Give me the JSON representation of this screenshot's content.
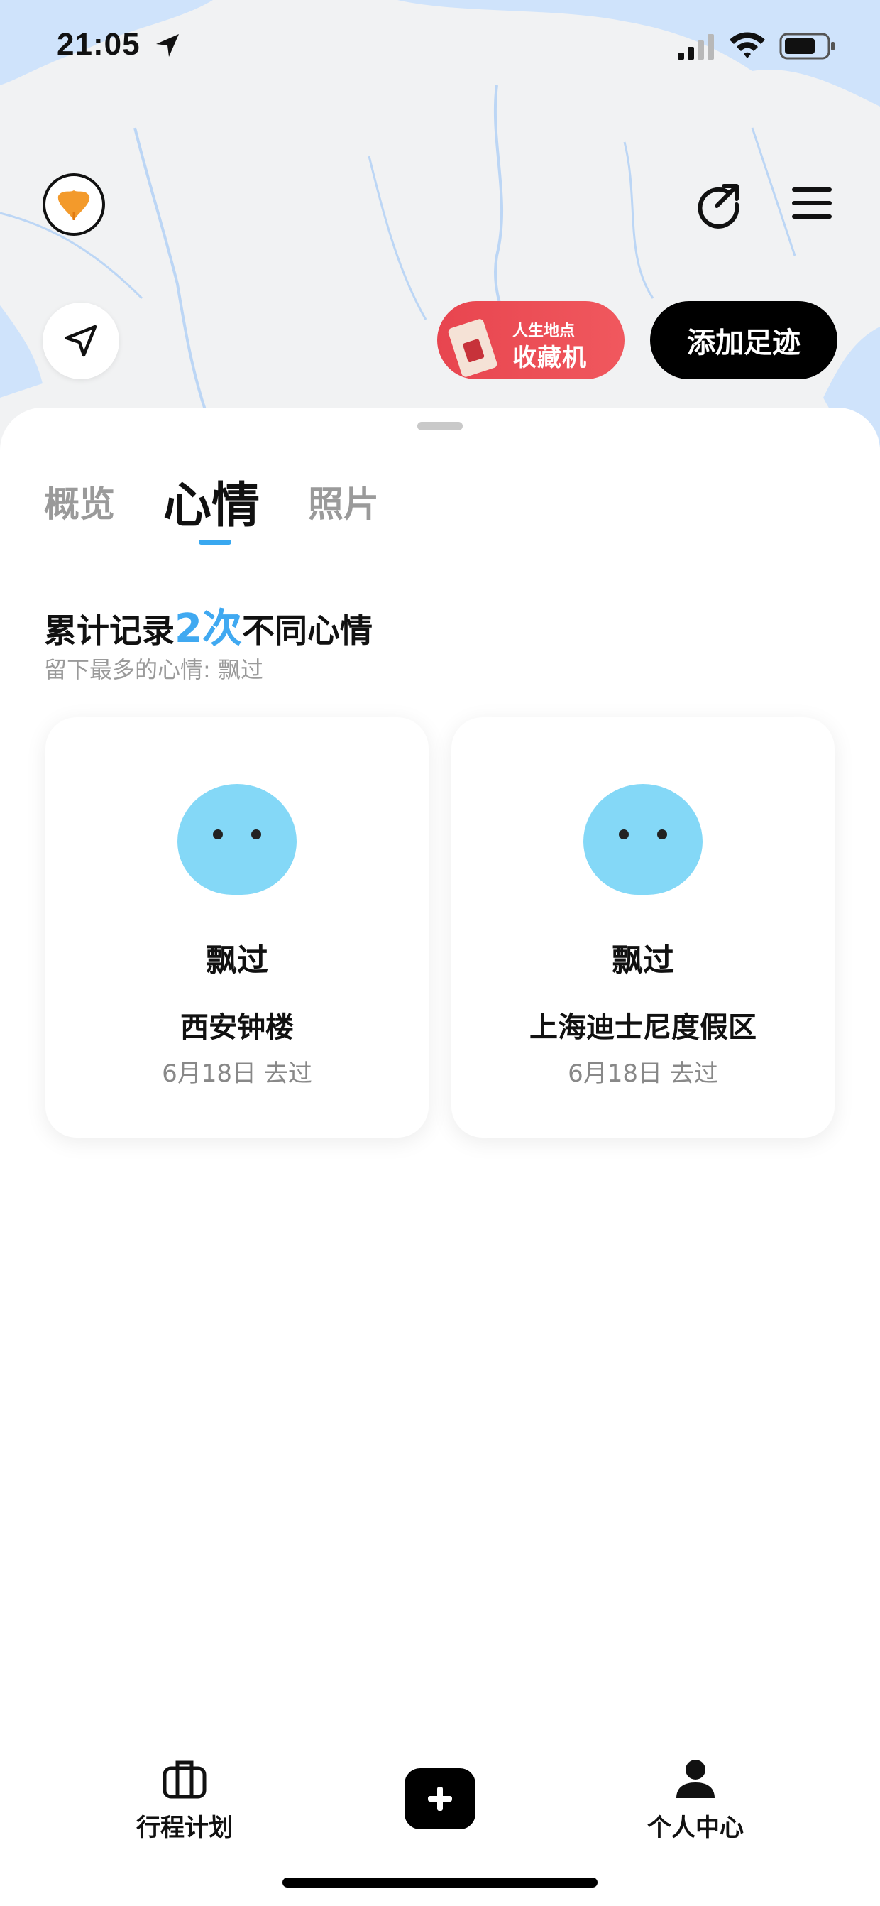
{
  "status_bar": {
    "time": "21:05"
  },
  "header": {
    "promo": {
      "line1": "人生地点",
      "line2": "收藏机"
    },
    "add_footprint_label": "添加足迹"
  },
  "tabs": [
    {
      "label": "概览",
      "active": false
    },
    {
      "label": "心情",
      "active": true
    },
    {
      "label": "照片",
      "active": false
    }
  ],
  "summary": {
    "prefix": "累计记录",
    "count": "2次",
    "suffix": "不同心情",
    "most_mood": "留下最多的心情: 飘过"
  },
  "mood_cards": [
    {
      "mood": "飘过",
      "place": "西安钟楼",
      "date": "6月18日 去过"
    },
    {
      "mood": "飘过",
      "place": "上海迪士尼度假区",
      "date": "6月18日 去过"
    }
  ],
  "bottom_nav": {
    "plan_label": "行程计划",
    "me_label": "个人中心"
  },
  "colors": {
    "accent": "#40a9f1",
    "face": "#84d8f7",
    "promo_red": "#e8454f",
    "logo_orange": "#f39a2b"
  },
  "icons": [
    "location-arrow-icon",
    "signal-icon",
    "wifi-icon",
    "battery-icon",
    "ginkgo-logo-icon",
    "share-icon",
    "menu-icon",
    "navigate-icon",
    "luggage-icon",
    "plus-icon",
    "person-icon"
  ]
}
